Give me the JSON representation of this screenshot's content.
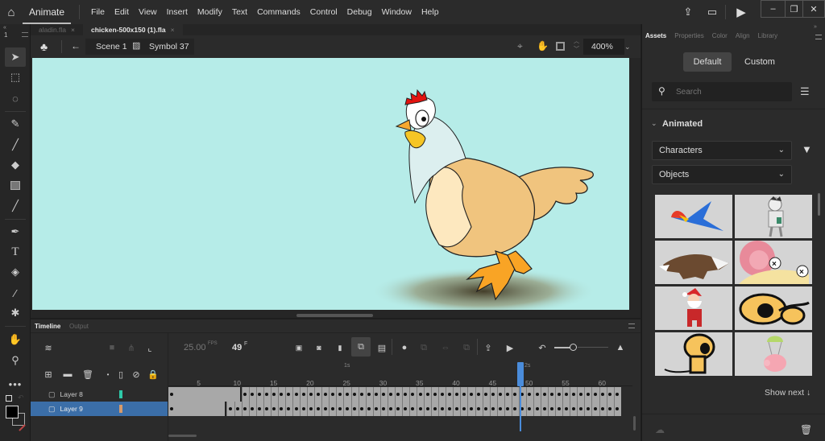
{
  "app": {
    "name": "Animate",
    "menu": [
      "File",
      "Edit",
      "View",
      "Insert",
      "Modify",
      "Text",
      "Commands",
      "Control",
      "Debug",
      "Window",
      "Help"
    ]
  },
  "document_tabs": [
    {
      "label": "aladin.fla",
      "active": false
    },
    {
      "label": "chicken-500x150 (1).fla",
      "active": true
    }
  ],
  "edit_bar": {
    "scene": "Scene 1",
    "symbol": "Symbol 37",
    "zoom": "400%"
  },
  "toolbar": {
    "collapse_label": "«",
    "index_label": "1",
    "tools": [
      "selection",
      "free-transform",
      "lasso",
      "paint-brush",
      "brush",
      "eraser",
      "rectangle",
      "line",
      "pen",
      "text",
      "paint-bucket",
      "eyedropper",
      "pin",
      "hand",
      "zoom",
      "more"
    ]
  },
  "right_panel": {
    "tabs": [
      "Assets",
      "Properties",
      "Color",
      "Align",
      "Library"
    ],
    "active_tab": "Assets",
    "segments": [
      "Default",
      "Custom"
    ],
    "active_segment": "Default",
    "search_placeholder": "Search",
    "section_title": "Animated",
    "category_dropdown": "Characters",
    "type_dropdown": "Objects",
    "assets": [
      "parrot",
      "mummy",
      "wolf",
      "snail",
      "santa",
      "dog-lying",
      "dog-sitting",
      "pig-parachute"
    ],
    "show_next": "Show next ↓"
  },
  "timeline": {
    "tabs": [
      "Timeline",
      "Output"
    ],
    "active_tab": "Timeline",
    "fps": "25.00",
    "fps_unit": "FPS",
    "current_frame": "49",
    "frame_unit": "F",
    "ruler_numbers": [
      "5",
      "10",
      "15",
      "20",
      "25",
      "30",
      "35",
      "40",
      "45",
      "50",
      "55",
      "60"
    ],
    "second_markers": [
      "1s",
      "2s"
    ],
    "layers": [
      {
        "name": "Layer 8",
        "color": "#2ec9a8",
        "selected": false,
        "keyframe_end": 10
      },
      {
        "name": "Layer 9",
        "color": "#d79a6a",
        "selected": true,
        "keyframe_end": 8
      }
    ],
    "total_frames": 62,
    "playhead_frame": 49
  },
  "colors": {
    "accent": "#3b6ea8",
    "stage_bg": "#b6ece8",
    "playhead": "#4a8cdb"
  }
}
